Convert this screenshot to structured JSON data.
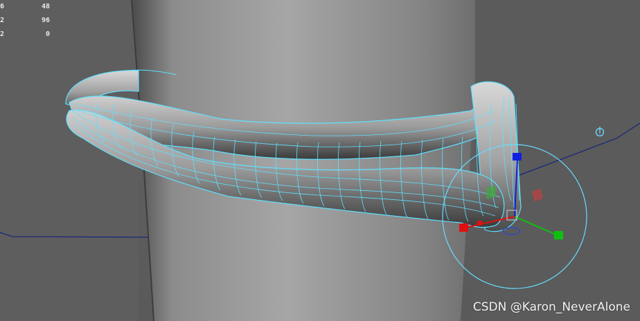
{
  "hud": {
    "rows": [
      {
        "label": "6",
        "value": "48"
      },
      {
        "label": "2",
        "value": "96"
      },
      {
        "label": "2",
        "value": "0"
      }
    ]
  },
  "watermark": "CSDN @Karon_NeverAlone",
  "colors": {
    "background": "#5d5d5d",
    "wireframe": "#5fe0ff",
    "axis_x": "#e01010",
    "axis_y": "#10c010",
    "axis_z": "#1020e0",
    "manipulator_ring": "#66ddff",
    "horizon_line": "#0a1a80"
  },
  "icons": [
    "rotate-pivot-icon"
  ]
}
